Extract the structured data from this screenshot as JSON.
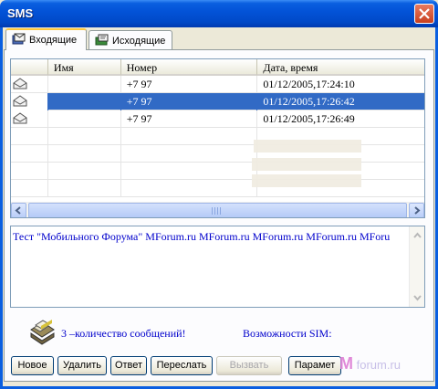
{
  "window": {
    "title": "SMS"
  },
  "tabs": [
    {
      "label": "Входящие",
      "active": true
    },
    {
      "label": "Исходящие",
      "active": false
    }
  ],
  "list": {
    "columns": [
      "",
      "Имя",
      "Номер",
      "Дата, время"
    ],
    "rows": [
      {
        "icon": "envelope-read-icon",
        "name": "",
        "number": "+7 97",
        "datetime": "01/12/2005,17:24:10",
        "selected": false
      },
      {
        "icon": "envelope-read-icon",
        "name": "",
        "number": "+7 97",
        "datetime": "01/12/2005,17:26:42",
        "selected": true
      },
      {
        "icon": "envelope-read-icon",
        "name": "",
        "number": "+7 97",
        "datetime": "01/12/2005,17:26:49",
        "selected": false
      }
    ]
  },
  "message": {
    "text": "Тест \"Мобильного Форума\" MForum.ru MForum.ru MForum.ru MForum.ru MForu"
  },
  "status": {
    "count_label": "3 –количество сообщений!",
    "sim_label": "Возможности SIM:"
  },
  "buttons": {
    "new": "Новое",
    "delete": "Удалить",
    "reply": "Ответ",
    "forward": "Переслать",
    "call": "Вызвать",
    "params": "Парамет"
  },
  "watermark": {
    "mark": "M",
    "text": "forum.ru"
  },
  "colors": {
    "titlebar": "#0353d8",
    "selection": "#316ac5",
    "link_text": "#0000cc",
    "window_bg": "#ece9d8"
  }
}
